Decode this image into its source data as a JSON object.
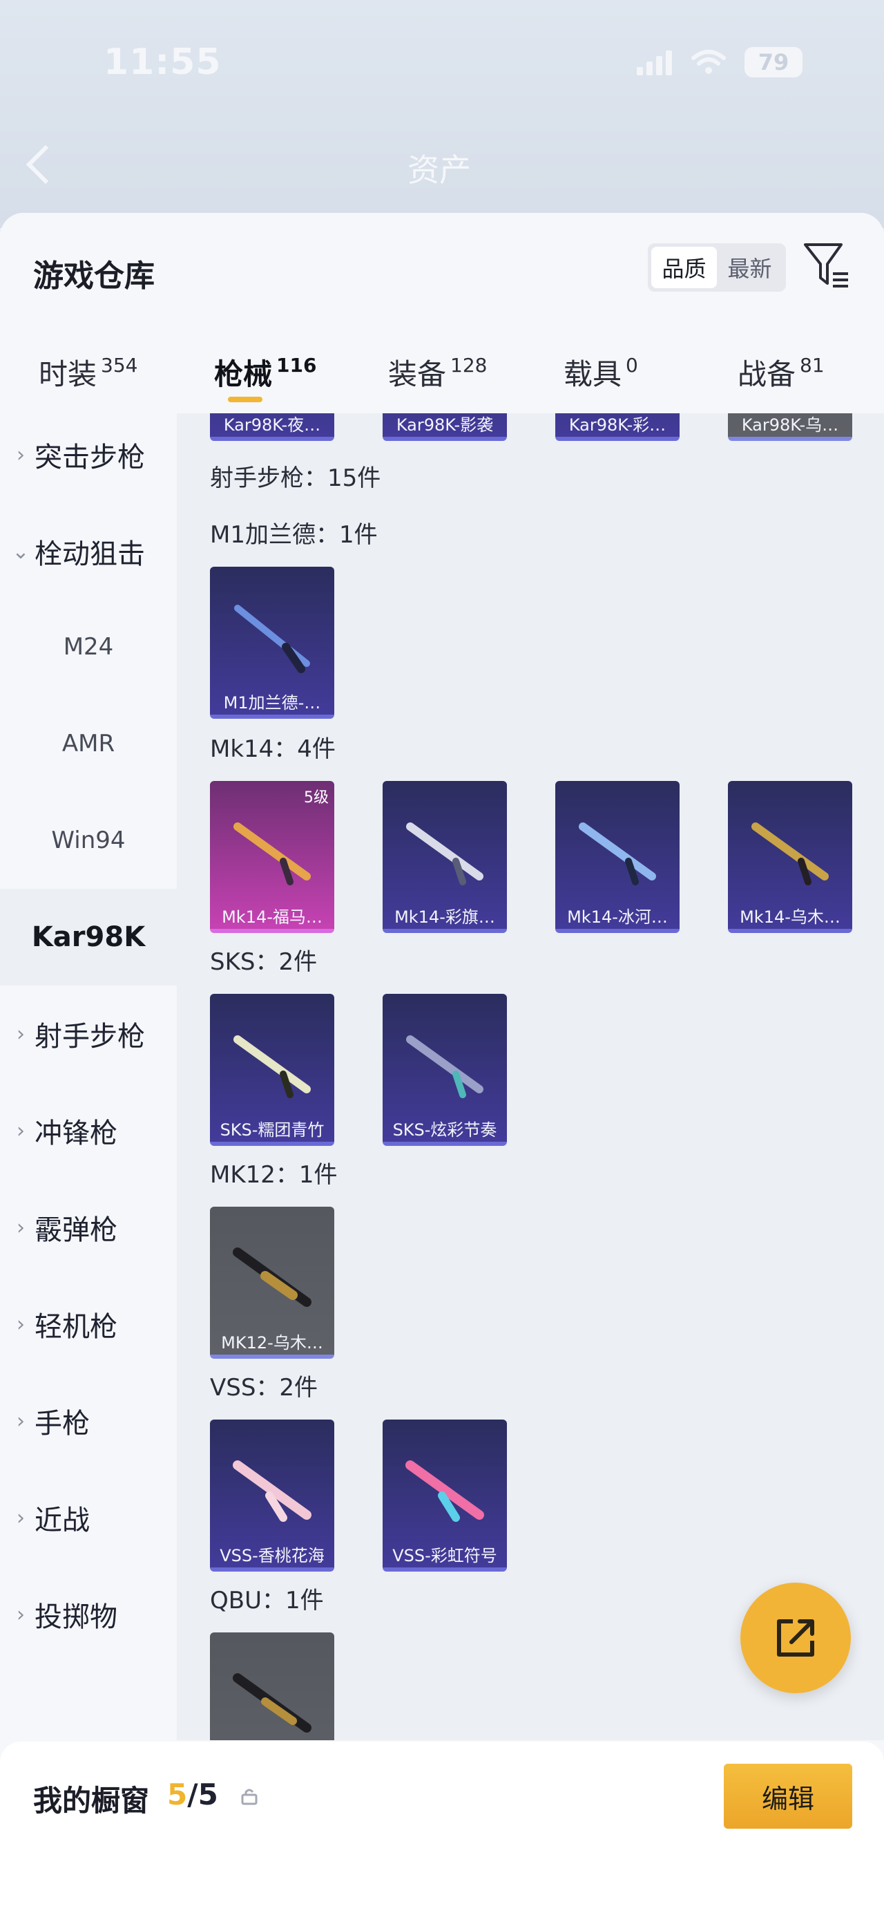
{
  "status": {
    "time": "11:55",
    "battery": "79"
  },
  "background": {
    "title": "资产"
  },
  "header": {
    "title": "游戏仓库",
    "sort": [
      "品质",
      "最新"
    ]
  },
  "tabs": [
    {
      "label": "时装",
      "count": "354"
    },
    {
      "label": "枪械",
      "count": "116"
    },
    {
      "label": "装备",
      "count": "128"
    },
    {
      "label": "载具",
      "count": "0"
    },
    {
      "label": "战备",
      "count": "81"
    }
  ],
  "sidebar": [
    {
      "label": "突击步枪"
    },
    {
      "label": "栓动狙击"
    },
    {
      "label": "M24"
    },
    {
      "label": "AMR"
    },
    {
      "label": "Win94"
    },
    {
      "label": "Kar98K"
    },
    {
      "label": "射手步枪"
    },
    {
      "label": "冲锋枪"
    },
    {
      "label": "霰弹枪"
    },
    {
      "label": "轻机枪"
    },
    {
      "label": "手枪"
    },
    {
      "label": "近战"
    },
    {
      "label": "投掷物"
    }
  ],
  "top_row": [
    "Kar98K-夜…",
    "Kar98K-影袭",
    "Kar98K-彩…",
    "Kar98K-乌…"
  ],
  "sections": {
    "marksman": "射手步枪：15件",
    "m1": "M1加兰德：1件",
    "mk14": "Mk14：4件",
    "sks": "SKS：2件",
    "mk12": "MK12：1件",
    "vss": "VSS：2件",
    "qbu": "QBU：1件"
  },
  "cards": {
    "m1": [
      "M1加兰德-…"
    ],
    "mk14": [
      "Mk14-福马…",
      "Mk14-彩旗…",
      "Mk14-冰河…",
      "Mk14-乌木…"
    ],
    "mk14_level": "5级",
    "sks": [
      "SKS-糯团青竹",
      "SKS-炫彩节奏"
    ],
    "mk12": [
      "MK12-乌木…"
    ],
    "vss": [
      "VSS-香桃花海",
      "VSS-彩虹符号"
    ]
  },
  "bottom": {
    "label": "我的橱窗",
    "count": "5",
    "total": "/5",
    "edit": "编辑"
  }
}
